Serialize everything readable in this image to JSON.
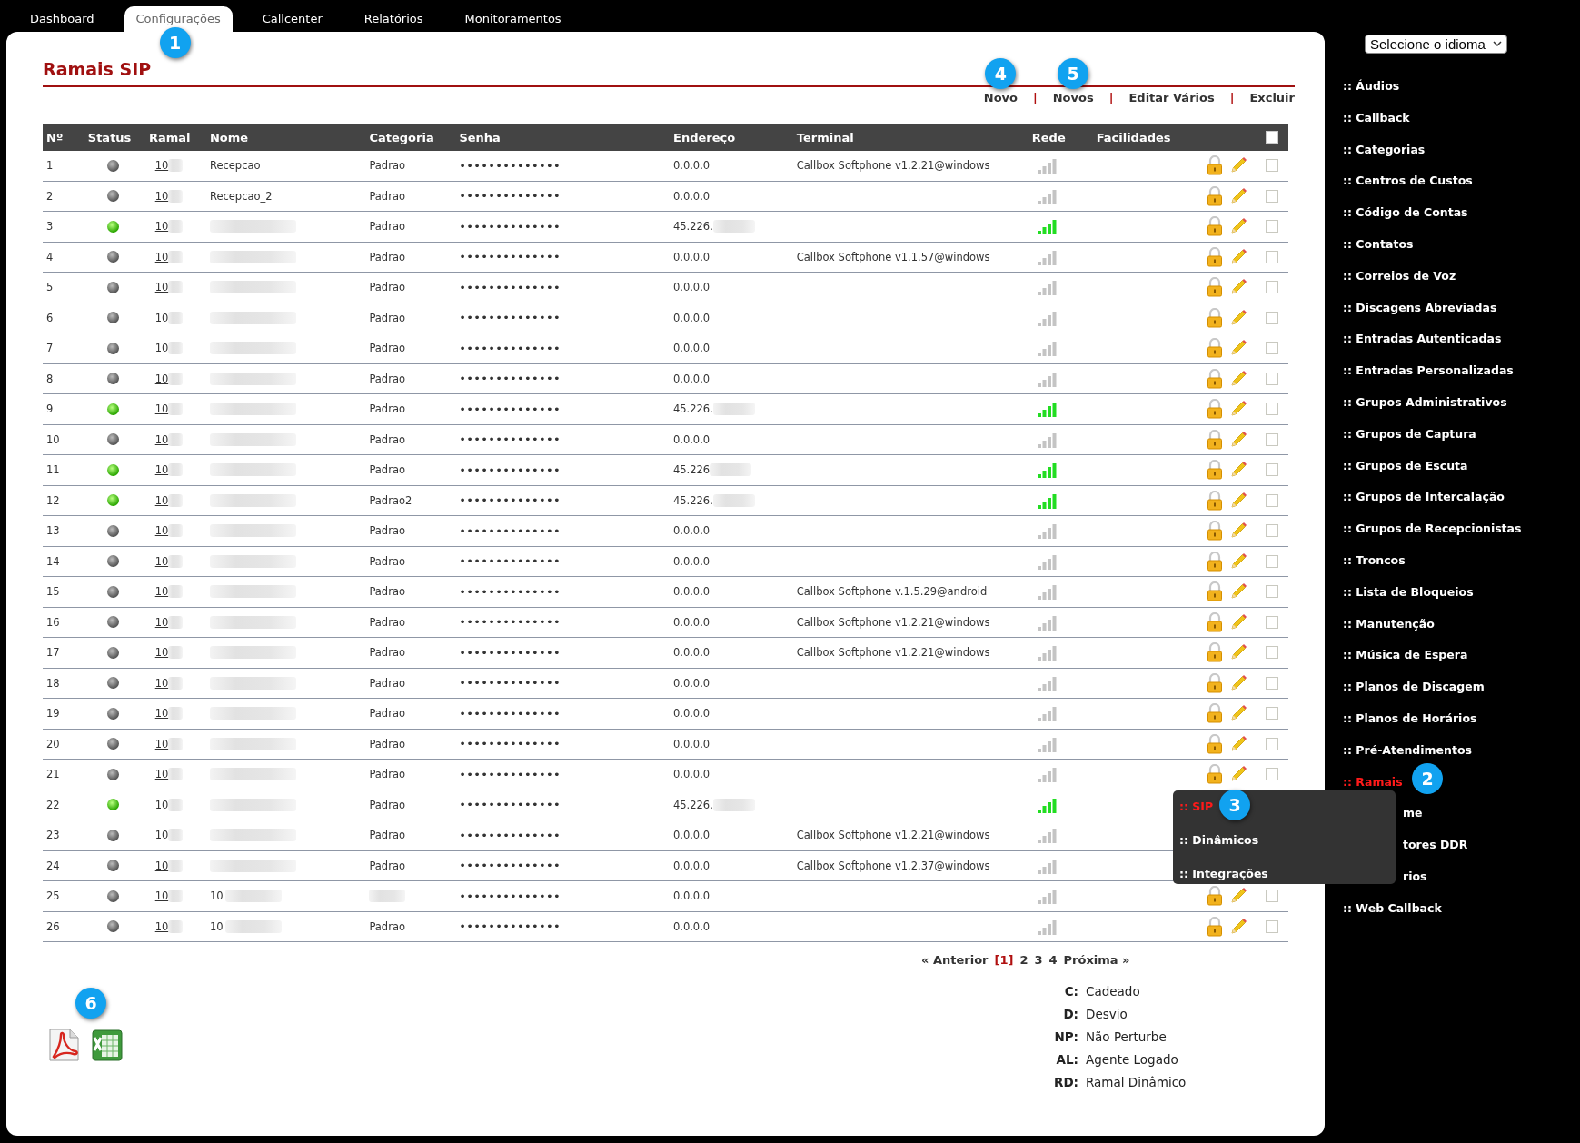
{
  "tabs": [
    {
      "label": "Dashboard",
      "selected": false
    },
    {
      "label": "Configurações",
      "selected": true,
      "badge": "1"
    },
    {
      "label": "Callcenter",
      "selected": false
    },
    {
      "label": "Relatórios",
      "selected": false
    },
    {
      "label": "Monitoramentos",
      "selected": false
    }
  ],
  "page_title": "Ramais SIP",
  "actions": [
    {
      "label": "Novo",
      "badge": "4"
    },
    {
      "sep": "|",
      "label": "Novos",
      "badge": "5"
    },
    {
      "sep": "|",
      "label": "Editar Vários"
    },
    {
      "sep": "|",
      "label": "Excluir"
    }
  ],
  "table": {
    "columns": [
      "Nº",
      "Status",
      "Ramal",
      "Nome",
      "Categoria",
      "Senha",
      "Endereço",
      "Terminal",
      "Rede",
      "Facilidades"
    ],
    "select_all": {
      "checked": false
    },
    "rows": [
      {
        "n": "1",
        "checked": false,
        "online": false,
        "ramal": "10",
        "nome": "Recepcao",
        "categoria": "Padrao",
        "senha": "••••••••••••••",
        "endereco": "0.0.0.0",
        "terminal": "Callbox Softphone v1.2.21@windows"
      },
      {
        "n": "2",
        "checked": false,
        "online": false,
        "ramal": "10",
        "nome": "Recepcao_2",
        "categoria": "Padrao",
        "senha": "••••••••••••••",
        "endereco": "0.0.0.0"
      },
      {
        "n": "3",
        "checked": false,
        "online": true,
        "ramal": "10",
        "nome_redacted": true,
        "categoria": "Padrao",
        "senha": "••••••••••••••",
        "endereco": "45.226.",
        "endereco_redacted": true
      },
      {
        "n": "4",
        "checked": false,
        "online": false,
        "ramal": "10",
        "nome_redacted": true,
        "categoria": "Padrao",
        "senha": "••••••••••••••",
        "endereco": "0.0.0.0",
        "terminal": "Callbox Softphone v1.1.57@windows"
      },
      {
        "n": "5",
        "checked": false,
        "online": false,
        "ramal": "10",
        "nome_redacted": true,
        "categoria": "Padrao",
        "senha": "••••••••••••••",
        "endereco": "0.0.0.0"
      },
      {
        "n": "6",
        "checked": false,
        "online": false,
        "ramal": "10",
        "nome_redacted": true,
        "categoria": "Padrao",
        "senha": "••••••••••••••",
        "endereco": "0.0.0.0"
      },
      {
        "n": "7",
        "checked": false,
        "online": false,
        "ramal": "10",
        "nome_redacted": true,
        "categoria": "Padrao",
        "senha": "••••••••••••••",
        "endereco": "0.0.0.0"
      },
      {
        "n": "8",
        "checked": false,
        "online": false,
        "ramal": "10",
        "nome_redacted": true,
        "categoria": "Padrao",
        "senha": "••••••••••••••",
        "endereco": "0.0.0.0"
      },
      {
        "n": "9",
        "checked": false,
        "online": true,
        "ramal": "10",
        "nome_redacted": true,
        "categoria": "Padrao",
        "senha": "••••••••••••••",
        "endereco": "45.226.",
        "endereco_redacted": true
      },
      {
        "n": "10",
        "checked": false,
        "online": false,
        "ramal": "10",
        "nome_redacted": true,
        "categoria": "Padrao",
        "senha": "••••••••••••••",
        "endereco": "0.0.0.0"
      },
      {
        "n": "11",
        "checked": false,
        "online": true,
        "ramal": "10",
        "nome_redacted": true,
        "categoria": "Padrao",
        "senha": "••••••••••••••",
        "endereco": "45.226",
        "endereco_redacted": true
      },
      {
        "n": "12",
        "checked": false,
        "online": true,
        "ramal": "10",
        "nome_redacted": true,
        "categoria": "Padrao2",
        "senha": "••••••••••••••",
        "endereco": "45.226.",
        "endereco_redacted": true
      },
      {
        "n": "13",
        "checked": false,
        "online": false,
        "ramal": "10",
        "nome_redacted": true,
        "categoria": "Padrao",
        "senha": "••••••••••••••",
        "endereco": "0.0.0.0"
      },
      {
        "n": "14",
        "checked": false,
        "online": false,
        "ramal": "10",
        "nome_redacted": true,
        "categoria": "Padrao",
        "senha": "••••••••••••••",
        "endereco": "0.0.0.0"
      },
      {
        "n": "15",
        "checked": false,
        "online": false,
        "ramal": "10",
        "nome_redacted": true,
        "categoria": "Padrao",
        "senha": "••••••••••••••",
        "endereco": "0.0.0.0",
        "terminal": "Callbox Softphone v.1.5.29@android"
      },
      {
        "n": "16",
        "checked": false,
        "online": false,
        "ramal": "10",
        "nome_redacted": true,
        "categoria": "Padrao",
        "senha": "••••••••••••••",
        "endereco": "0.0.0.0",
        "terminal": "Callbox Softphone v1.2.21@windows"
      },
      {
        "n": "17",
        "checked": false,
        "online": false,
        "ramal": "10",
        "nome_redacted": true,
        "categoria": "Padrao",
        "senha": "••••••••••••••",
        "endereco": "0.0.0.0",
        "terminal": "Callbox Softphone v1.2.21@windows"
      },
      {
        "n": "18",
        "checked": false,
        "online": false,
        "ramal": "10",
        "nome_redacted": true,
        "categoria": "Padrao",
        "senha": "••••••••••••••",
        "endereco": "0.0.0.0"
      },
      {
        "n": "19",
        "checked": false,
        "online": false,
        "ramal": "10",
        "nome_redacted": true,
        "categoria": "Padrao",
        "senha": "••••••••••••••",
        "endereco": "0.0.0.0"
      },
      {
        "n": "20",
        "checked": false,
        "online": false,
        "ramal": "10",
        "nome_redacted": true,
        "categoria": "Padrao",
        "senha": "••••••••••••••",
        "endereco": "0.0.0.0"
      },
      {
        "n": "21",
        "checked": false,
        "online": false,
        "ramal": "10",
        "nome_redacted": true,
        "categoria": "Padrao",
        "senha": "••••••••••••••",
        "endereco": "0.0.0.0"
      },
      {
        "n": "22",
        "online": true,
        "ramal": "10",
        "nome_redacted": true,
        "categoria": "Padrao",
        "senha": "••••••••••••••",
        "endereco": "45.226.",
        "endereco_redacted": true,
        "covered": true
      },
      {
        "n": "23",
        "online": false,
        "ramal": "10",
        "nome_redacted": true,
        "categoria": "Padrao",
        "senha": "••••••••••••••",
        "endereco": "0.0.0.0",
        "terminal": "Callbox Softphone v1.2.21@windows",
        "covered": true
      },
      {
        "n": "24",
        "online": false,
        "ramal": "10",
        "nome_redacted": true,
        "categoria": "Padrao",
        "senha": "••••••••••••••",
        "endereco": "0.0.0.0",
        "terminal": "Callbox Softphone v1.2.37@windows",
        "covered": true
      },
      {
        "n": "25",
        "checked": false,
        "online": false,
        "ramal": "10",
        "nome": "10",
        "nome_redacted": true,
        "categoria_redacted": true,
        "senha": "••••••••••••••",
        "endereco": "0.0.0.0"
      },
      {
        "n": "26",
        "checked": false,
        "online": false,
        "ramal": "10",
        "nome": "10",
        "nome_redacted": true,
        "categoria": "Padrao",
        "senha": "••••••••••••••",
        "endereco": "0.0.0.0"
      }
    ]
  },
  "pagination": {
    "prev": "« Anterior",
    "pages": [
      {
        "label": "[1]",
        "selected": true
      },
      {
        "label": "2",
        "selected": false
      },
      {
        "label": "3",
        "selected": false
      },
      {
        "label": "4",
        "selected": false
      }
    ],
    "next": "Próxima »"
  },
  "export_badge": "6",
  "legend": [
    {
      "code": "C:",
      "text": "Cadeado"
    },
    {
      "code": "D:",
      "text": "Desvio"
    },
    {
      "code": "NP:",
      "text": "Não Perturbe"
    },
    {
      "code": "AL:",
      "text": "Agente Logado"
    },
    {
      "code": "RD:",
      "text": "Ramal Dinâmico"
    }
  ],
  "language_select": {
    "value": "Selecione o idioma"
  },
  "sidebar": {
    "items": [
      {
        "label": ":: Áudios",
        "selected": false
      },
      {
        "label": ":: Callback",
        "selected": false
      },
      {
        "label": ":: Categorias",
        "selected": false
      },
      {
        "label": ":: Centros de Custos",
        "selected": false
      },
      {
        "label": ":: Código de Contas",
        "selected": false
      },
      {
        "label": ":: Contatos",
        "selected": false
      },
      {
        "label": ":: Correios de Voz",
        "selected": false
      },
      {
        "label": ":: Discagens Abreviadas",
        "selected": false
      },
      {
        "label": ":: Entradas Autenticadas",
        "selected": false
      },
      {
        "label": ":: Entradas Personalizadas",
        "selected": false
      },
      {
        "label": ":: Grupos Administrativos",
        "selected": false
      },
      {
        "label": ":: Grupos de Captura",
        "selected": false
      },
      {
        "label": ":: Grupos de Escuta",
        "selected": false
      },
      {
        "label": ":: Grupos de Intercalação",
        "selected": false
      },
      {
        "label": ":: Grupos de Recepcionistas",
        "selected": false
      },
      {
        "label": ":: Troncos",
        "selected": false
      },
      {
        "label": ":: Lista de Bloqueios",
        "selected": false
      },
      {
        "label": ":: Manutenção",
        "selected": false
      },
      {
        "label": ":: Música de Espera",
        "selected": false
      },
      {
        "label": ":: Planos de Discagem",
        "selected": false
      },
      {
        "label": ":: Planos de Horários",
        "selected": false
      },
      {
        "label": ":: Pré-Atendimentos",
        "selected": false
      },
      {
        "label": ":: Ramais",
        "selected": true,
        "badge": "2"
      },
      {
        "label": "me",
        "selected": false,
        "covered": true
      },
      {
        "label": "tores DDR",
        "selected": false,
        "covered": true
      },
      {
        "label": "rios",
        "selected": false,
        "covered": true
      },
      {
        "label": ":: Web Callback",
        "selected": false
      }
    ]
  },
  "submenu": {
    "items": [
      {
        "label": ":: SIP",
        "selected": true,
        "badge": "3"
      },
      {
        "label": ":: Dinâmicos",
        "selected": false
      },
      {
        "label": ":: Integrações",
        "selected": false
      }
    ]
  }
}
